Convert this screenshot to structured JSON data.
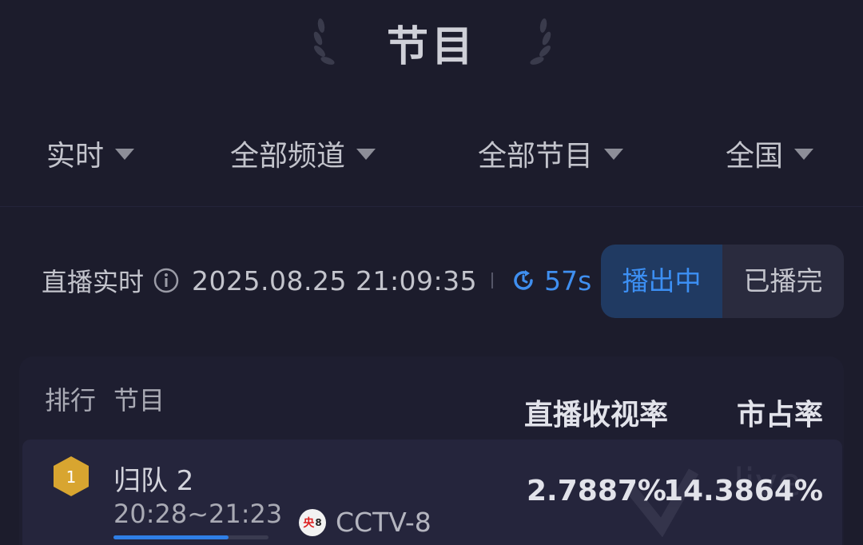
{
  "header": {
    "title": "节目"
  },
  "filters": [
    {
      "label": "实时"
    },
    {
      "label": "全部频道"
    },
    {
      "label": "全部节目"
    },
    {
      "label": "全国"
    }
  ],
  "status": {
    "live_label": "直播实时",
    "datetime": "2025.08.25 21:09:35",
    "countdown": "57s",
    "accent": "#3f8ff0"
  },
  "toggle": {
    "active": "播出中",
    "inactive": "已播完"
  },
  "table": {
    "headers": {
      "rank": "排行",
      "program": "节目",
      "rating": "直播收视率",
      "share": "市占率"
    },
    "rows": [
      {
        "rank": "1",
        "title": "归队 2",
        "time": "20:28~21:23",
        "progress": 0.74,
        "channel_logo": [
          "央",
          "8"
        ],
        "channel": "CCTV-8",
        "rating": "2.7887%",
        "share": "14.3864%"
      }
    ]
  },
  "colors": {
    "background": "#1c1c2c",
    "gold_badge": "#d8a530",
    "progress": "#2f7fe6"
  }
}
